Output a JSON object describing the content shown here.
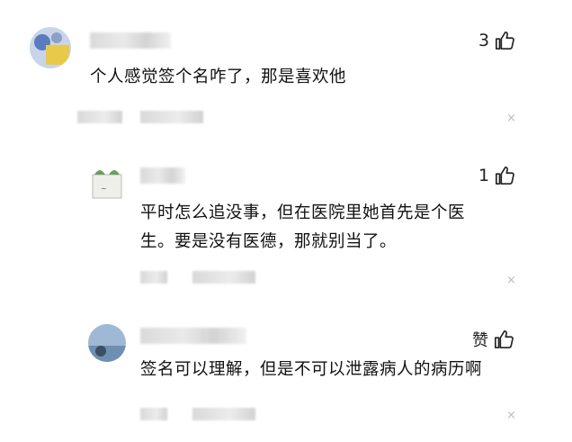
{
  "comments": [
    {
      "likes": "3",
      "text": "个人感觉签个名咋了，那是喜欢他",
      "close": "×"
    },
    {
      "likes": "1",
      "text_line1": "平时怎么追没事，但在医院里她首先是个医",
      "text_line2": "生。要是没有医德，那就别当了。",
      "close": "×"
    },
    {
      "likes": "赞",
      "text": "签名可以理解，但是不可以泄露病人的病历啊",
      "close": "×"
    }
  ],
  "icons": {
    "like": "thumbs-up-icon",
    "close": "close-icon"
  },
  "colors": {
    "text": "#111111",
    "muted": "#bbbbbb",
    "avatar1_bg": "#e9c94a",
    "avatar1_ring": "#5a7bbd",
    "avatar3_bg": "#7da3c8"
  }
}
